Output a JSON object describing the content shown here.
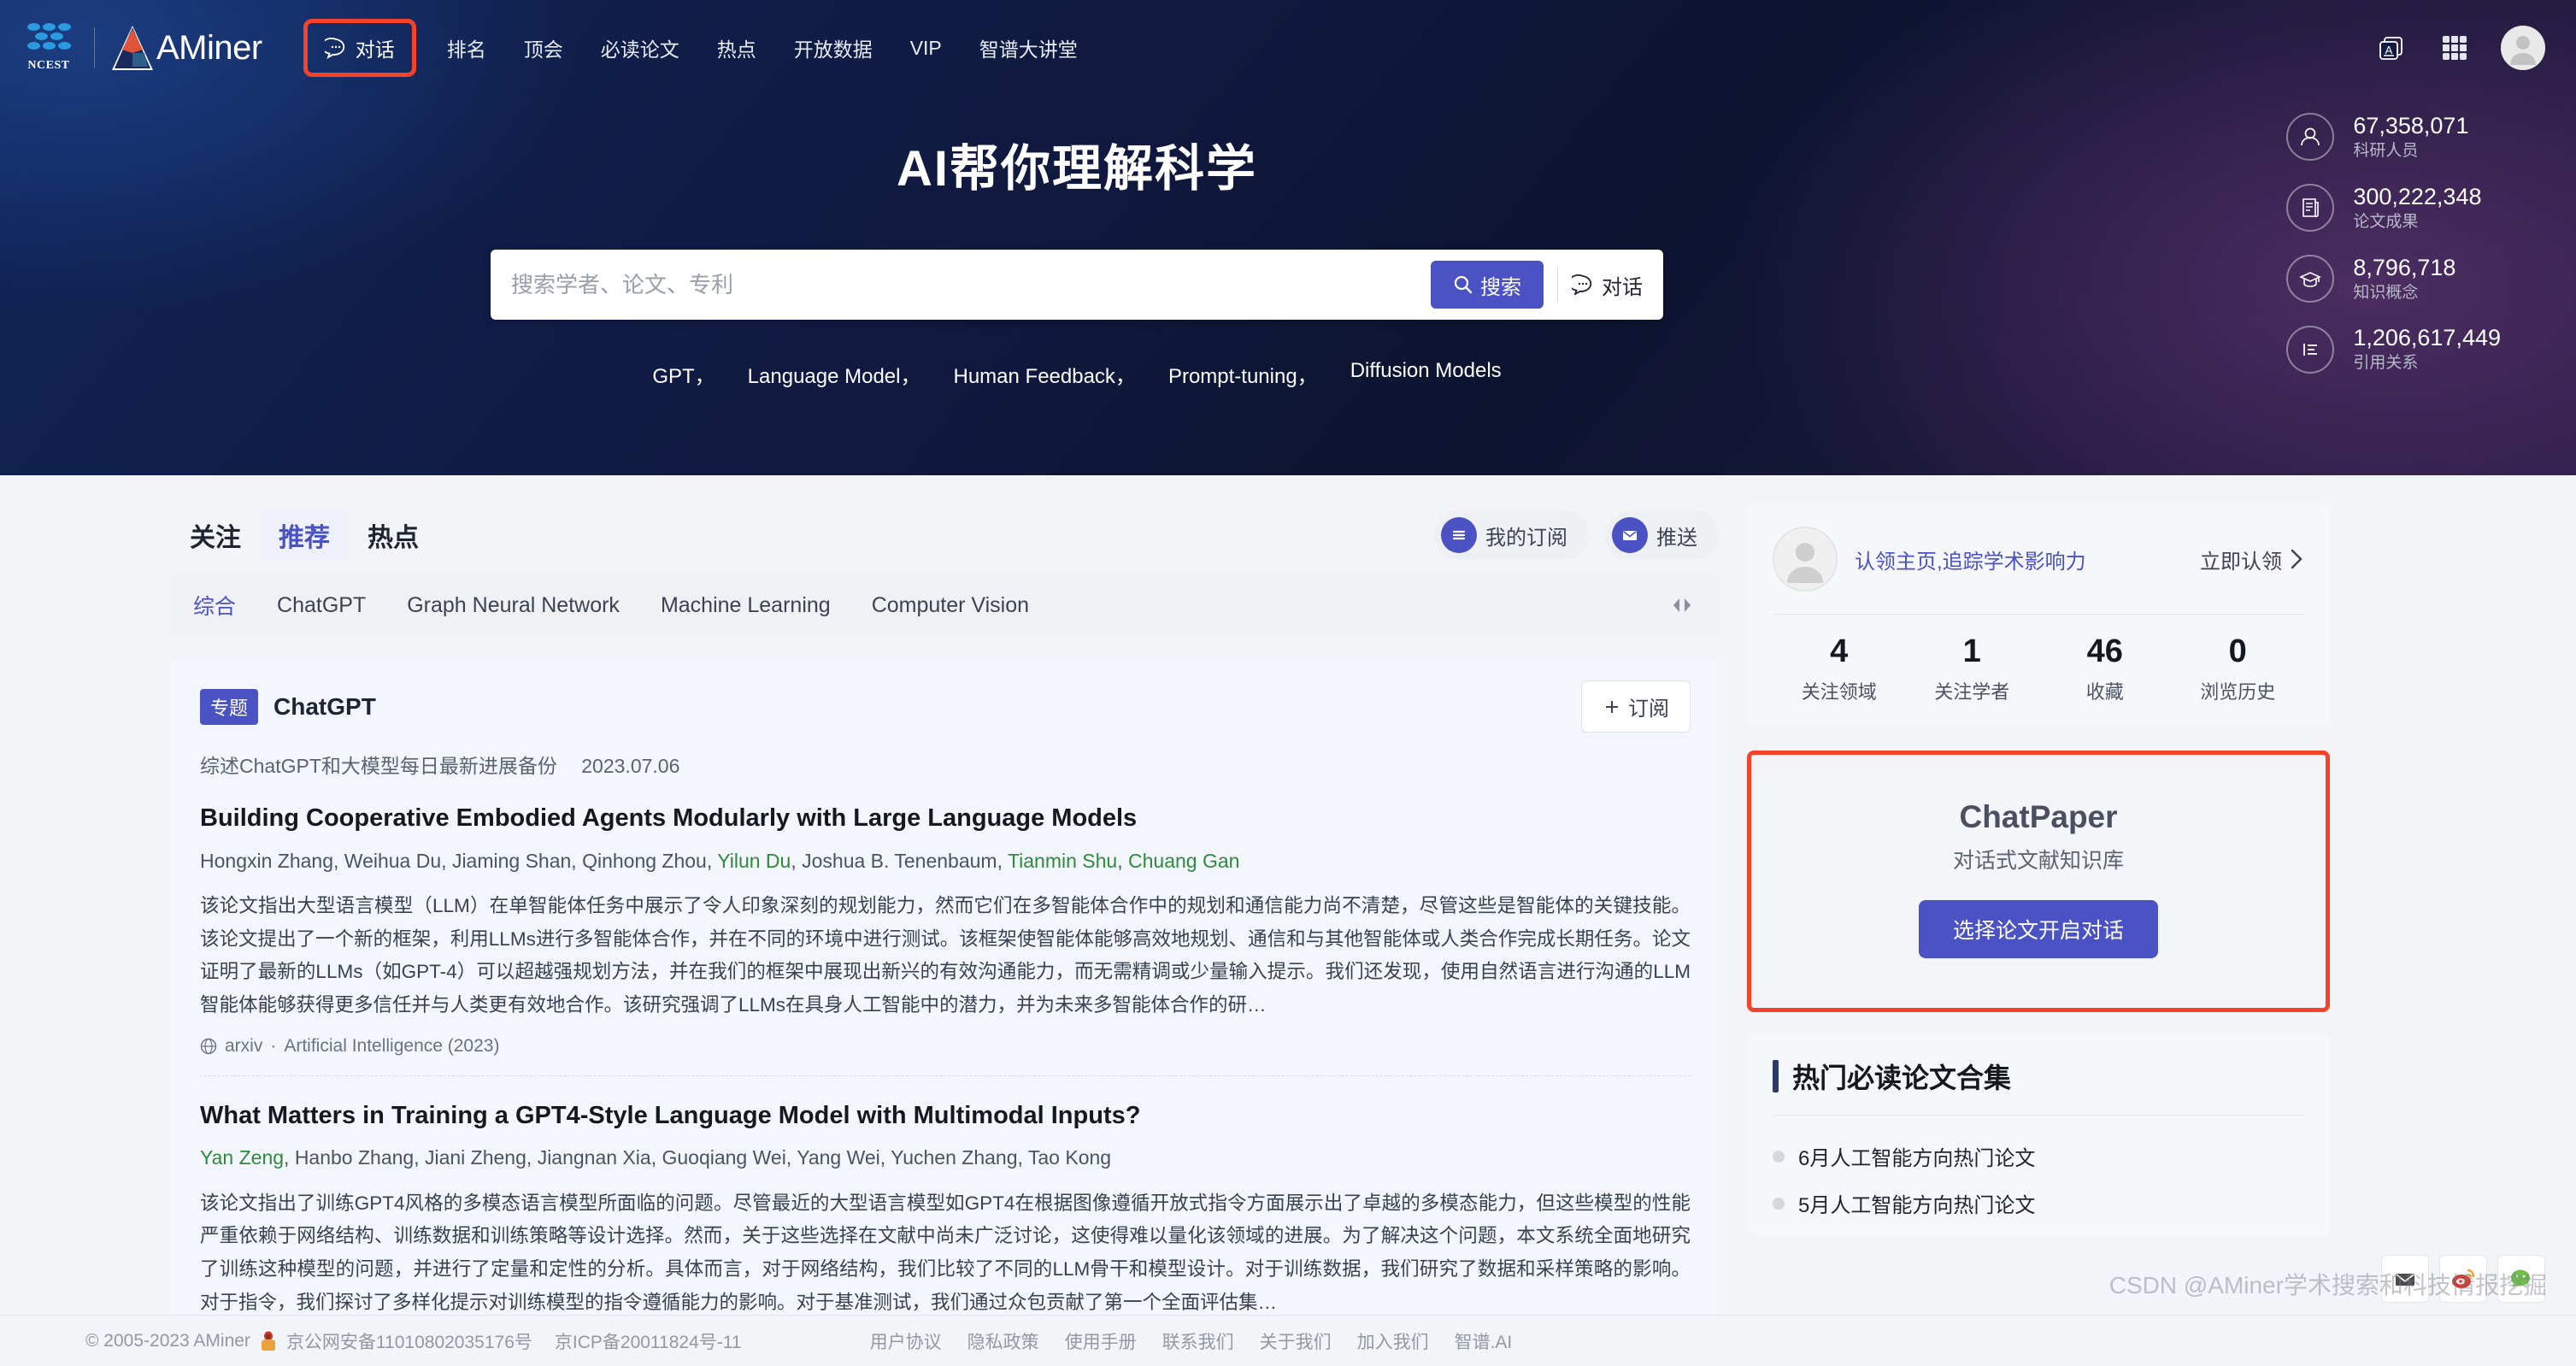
{
  "header": {
    "brand_ncest": "NCEST",
    "brand_aminer": "AMiner",
    "nav": [
      {
        "label": "对话",
        "icon": "chat-bubble-icon",
        "highlighted": true
      },
      {
        "label": "排名",
        "highlighted": false
      },
      {
        "label": "顶会",
        "highlighted": false
      },
      {
        "label": "必读论文",
        "highlighted": false
      },
      {
        "label": "热点",
        "highlighted": false
      },
      {
        "label": "开放数据",
        "highlighted": false
      },
      {
        "label": "VIP",
        "highlighted": false
      },
      {
        "label": "智谱大讲堂",
        "highlighted": false
      }
    ],
    "right_icons": [
      "translate-card-icon",
      "apps-grid-icon",
      "user-avatar-icon"
    ]
  },
  "hero": {
    "title": "AI帮你理解科学",
    "search": {
      "placeholder": "搜索学者、论文、专利",
      "value": "",
      "search_button": "搜索",
      "chat_button": "对话"
    },
    "keywords": [
      "GPT，",
      "Language Model，",
      "Human Feedback，",
      "Prompt-tuning，",
      "Diffusion Models"
    ],
    "stats": [
      {
        "icon": "person-icon",
        "value": "67,358,071",
        "label": "科研人员"
      },
      {
        "icon": "paper-icon",
        "value": "300,222,348",
        "label": "论文成果"
      },
      {
        "icon": "graduation-cap-icon",
        "value": "8,796,718",
        "label": "知识概念"
      },
      {
        "icon": "citation-list-icon",
        "value": "1,206,617,449",
        "label": "引用关系"
      }
    ]
  },
  "main": {
    "tabs": [
      {
        "label": "关注",
        "active": false
      },
      {
        "label": "推荐",
        "active": true
      },
      {
        "label": "热点",
        "active": false
      }
    ],
    "actions": [
      {
        "label": "我的订阅",
        "icon": "list-lines-icon"
      },
      {
        "label": "推送",
        "icon": "envelope-icon"
      }
    ],
    "filters": [
      {
        "label": "综合",
        "active": true
      },
      {
        "label": "ChatGPT",
        "active": false
      },
      {
        "label": "Graph Neural Network",
        "active": false
      },
      {
        "label": "Machine Learning",
        "active": false
      },
      {
        "label": "Computer Vision",
        "active": false
      }
    ],
    "card": {
      "badge": "专题",
      "title": "ChatGPT",
      "subscribe_label": "订阅",
      "subtitle": "综述ChatGPT和大模型每日最新进展备份",
      "date": "2023.07.06"
    },
    "papers": [
      {
        "title": "Building Cooperative Embodied Agents Modularly with Large Language Models",
        "authors": [
          {
            "name": "Hongxin Zhang",
            "highlight": false
          },
          {
            "name": "Weihua Du",
            "highlight": false
          },
          {
            "name": "Jiaming Shan",
            "highlight": false
          },
          {
            "name": "Qinhong Zhou",
            "highlight": false
          },
          {
            "name": "Yilun Du",
            "highlight": true
          },
          {
            "name": "Joshua B. Tenenbaum",
            "highlight": false
          },
          {
            "name": "Tianmin Shu",
            "highlight": true
          },
          {
            "name": "Chuang Gan",
            "highlight": true
          }
        ],
        "abstract": "该论文指出大型语言模型（LLM）在单智能体任务中展示了令人印象深刻的规划能力，然而它们在多智能体合作中的规划和通信能力尚不清楚，尽管这些是智能体的关键技能。该论文提出了一个新的框架，利用LLMs进行多智能体合作，并在不同的环境中进行测试。该框架使智能体能够高效地规划、通信和与其他智能体或人类合作完成长期任务。论文证明了最新的LLMs（如GPT-4）可以超越强规划方法，并在我们的框架中展现出新兴的有效沟通能力，而无需精调或少量输入提示。我们还发现，使用自然语言进行沟通的LLM智能体能够获得更多信任并与人类更有效地合作。该研究强调了LLMs在具身人工智能中的潜力，并为未来多智能体合作的研…",
        "source": "arxiv",
        "venue": "Artificial Intelligence (2023)"
      },
      {
        "title": "What Matters in Training a GPT4-Style Language Model with Multimodal Inputs?",
        "authors": [
          {
            "name": "Yan Zeng",
            "highlight": true
          },
          {
            "name": "Hanbo Zhang",
            "highlight": false
          },
          {
            "name": "Jiani Zheng",
            "highlight": false
          },
          {
            "name": "Jiangnan Xia",
            "highlight": false
          },
          {
            "name": "Guoqiang Wei",
            "highlight": false
          },
          {
            "name": "Yang Wei",
            "highlight": false
          },
          {
            "name": "Yuchen Zhang",
            "highlight": false
          },
          {
            "name": "Tao Kong",
            "highlight": false
          }
        ],
        "abstract": "该论文指出了训练GPT4风格的多模态语言模型所面临的问题。尽管最近的大型语言模型如GPT4在根据图像遵循开放式指令方面展示出了卓越的多模态能力，但这些模型的性能严重依赖于网络结构、训练数据和训练策略等设计选择。然而，关于这些选择在文献中尚未广泛讨论，这使得难以量化该领域的进展。为了解决这个问题，本文系统全面地研究了训练这种模型的问题，并进行了定量和定性的分析。具体而言，对于网络结构，我们比较了不同的LLM骨干和模型设计。对于训练数据，我们研究了数据和采样策略的影响。对于指令，我们探讨了多样化提示对训练模型的指令遵循能力的影响。对于基准测试，我们通过众包贡献了第一个全面评估集…",
        "source": "",
        "venue": ""
      }
    ]
  },
  "sidebar": {
    "claim": {
      "text": "认领主页,追踪学术影响力",
      "link": "立即认领"
    },
    "stats": [
      {
        "value": "4",
        "label": "关注领域"
      },
      {
        "value": "1",
        "label": "关注学者"
      },
      {
        "value": "46",
        "label": "收藏"
      },
      {
        "value": "0",
        "label": "浏览历史"
      }
    ],
    "chatpaper": {
      "title": "ChatPaper",
      "subtitle": "对话式文献知识库",
      "button": "选择论文开启对话"
    },
    "hot": {
      "title": "热门必读论文合集",
      "items": [
        {
          "label": "6月人工智能方向热门论文"
        },
        {
          "label": "5月人工智能方向热门论文"
        }
      ]
    }
  },
  "footer": {
    "copyright": "© 2005-2023 AMiner",
    "police": "京公网安备11010802035176号",
    "icp": "京ICP备20011824号-11",
    "links": [
      "用户协议",
      "隐私政策",
      "使用手册",
      "联系我们",
      "关于我们",
      "加入我们",
      "智谱.AI"
    ]
  },
  "float_buttons": [
    {
      "icon": "envelope-icon"
    },
    {
      "icon": "weibo-icon"
    },
    {
      "icon": "wechat-icon"
    }
  ],
  "watermark": "CSDN @AMiner学术搜索和科技情报挖掘",
  "colors": {
    "accent": "#4a52c4",
    "highlight_border": "#f4422b",
    "author_highlight": "#2f8a3b"
  }
}
